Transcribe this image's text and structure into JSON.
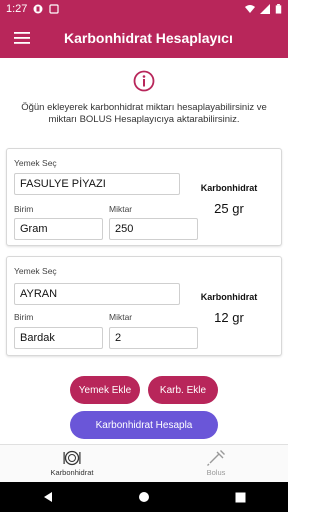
{
  "status_bar": {
    "time": "1:27"
  },
  "app_bar": {
    "title": "Karbonhidrat Hesaplayıcı"
  },
  "info": {
    "text": "Öğün ekleyerek karbonhidrat miktarı hesaplayabilirsiniz ve miktarı BOLUS Hesaplayıcıya aktarabilirsiniz."
  },
  "items": [
    {
      "food_label": "Yemek Seç",
      "food": "FASULYE PİYAZI",
      "unit_label": "Birim",
      "unit": "Gram",
      "amount_label": "Miktar",
      "amount": "250",
      "carb_label": "Karbonhidrat",
      "carb_value": "25 gr"
    },
    {
      "food_label": "Yemek Seç",
      "food": "AYRAN",
      "unit_label": "Birim",
      "unit": "Bardak",
      "amount_label": "Miktar",
      "amount": "2",
      "carb_label": "Karbonhidrat",
      "carb_value": "12 gr"
    }
  ],
  "buttons": {
    "add_food": "Yemek Ekle",
    "add_carb": "Karb. Ekle",
    "calculate": "Karbonhidrat Hesapla"
  },
  "bottom_nav": {
    "carb": "Karbonhidrat",
    "bolus": "Bolus"
  },
  "colors": {
    "primary": "#b8265a",
    "accent": "#6a56d8"
  }
}
